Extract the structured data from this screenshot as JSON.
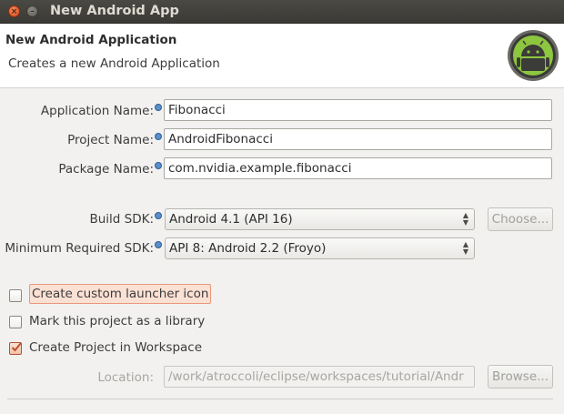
{
  "window": {
    "title": "New Android App"
  },
  "header": {
    "title": "New Android Application",
    "subtitle": "Creates a new Android Application",
    "logo_icon": "android-logo-icon"
  },
  "form": {
    "application_name": {
      "label": "Application Name:",
      "value": "Fibonacci"
    },
    "project_name": {
      "label": "Project Name:",
      "value": "AndroidFibonacci"
    },
    "package_name": {
      "label": "Package Name:",
      "value": "com.nvidia.example.fibonacci"
    },
    "build_sdk": {
      "label": "Build SDK:",
      "value": "Android 4.1 (API 16)",
      "button": "Choose..."
    },
    "min_sdk": {
      "label": "Minimum Required SDK:",
      "value": "API 8: Android 2.2 (Froyo)"
    }
  },
  "options": [
    {
      "label": "Create custom launcher icon",
      "checked": false
    },
    {
      "label": "Mark this project as a library",
      "checked": false
    },
    {
      "label": "Create Project in Workspace",
      "checked": true
    }
  ],
  "location": {
    "label": "Location:",
    "value": "/work/atroccoli/eclipse/workspaces/tutorial/Andr",
    "button": "Browse..."
  },
  "colors": {
    "accent": "#e8987a",
    "titlebar": "#3c3b37",
    "android_green": "#8dc63f"
  }
}
